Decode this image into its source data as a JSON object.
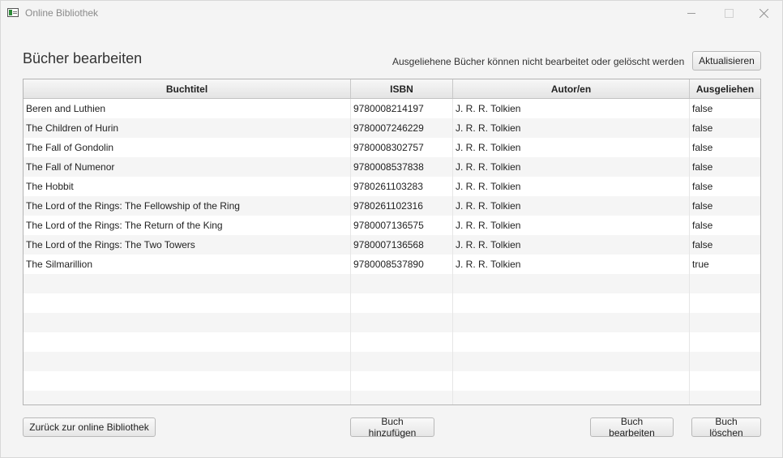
{
  "window": {
    "title": "Online Bibliothek",
    "icon": "book-app-icon"
  },
  "header": {
    "title": "Bücher bearbeiten",
    "info": "Ausgeliehene Bücher können nicht bearbeitet oder gelöscht werden",
    "refresh_label": "Aktualisieren"
  },
  "table": {
    "columns": [
      "Buchtitel",
      "ISBN",
      "Autor/en",
      "Ausgeliehen"
    ],
    "rows": [
      {
        "title": "Beren and Luthien",
        "isbn": "9780008214197",
        "author": "J. R. R. Tolkien",
        "borrowed": "false"
      },
      {
        "title": "The Children of Hurin",
        "isbn": "9780007246229",
        "author": "J. R. R. Tolkien",
        "borrowed": "false"
      },
      {
        "title": "The Fall of Gondolin",
        "isbn": "9780008302757",
        "author": "J. R. R. Tolkien",
        "borrowed": "false"
      },
      {
        "title": "The Fall of Numenor",
        "isbn": "9780008537838",
        "author": "J. R. R. Tolkien",
        "borrowed": "false"
      },
      {
        "title": "The Hobbit",
        "isbn": "9780261103283",
        "author": "J. R. R. Tolkien",
        "borrowed": "false"
      },
      {
        "title": "The Lord of the Rings: The Fellowship of the Ring",
        "isbn": "9780261102316",
        "author": "J. R. R. Tolkien",
        "borrowed": "false"
      },
      {
        "title": "The Lord of the Rings: The Return of the King",
        "isbn": "9780007136575",
        "author": "J. R. R. Tolkien",
        "borrowed": "false"
      },
      {
        "title": "The Lord of the Rings: The Two Towers",
        "isbn": "9780007136568",
        "author": "J. R. R. Tolkien",
        "borrowed": "false"
      },
      {
        "title": "The Silmarillion",
        "isbn": "9780008537890",
        "author": "J. R. R. Tolkien",
        "borrowed": "true"
      }
    ]
  },
  "footer": {
    "back_label": "Zurück zur online Bibliothek",
    "add_label": "Buch hinzufügen",
    "edit_label": "Buch bearbeiten",
    "delete_label": "Buch löschen"
  }
}
